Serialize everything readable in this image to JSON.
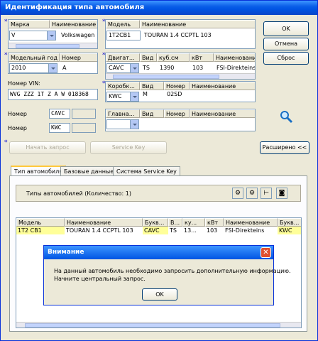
{
  "window": {
    "title": "Идентификация типа автомобиля"
  },
  "buttons": {
    "ok": "OK",
    "cancel": "Отмена",
    "reset": "Сброс",
    "start_query": "Начать запрос",
    "service_key": "Service Key",
    "advanced": "Расширено <<"
  },
  "brand": {
    "col1": "Марка",
    "col2": "Наименование",
    "value": "V",
    "name": "Volkswagen"
  },
  "model": {
    "col1": "Модель",
    "col2": "Наименование",
    "value": "1T2CB1",
    "name": "TOURAN 1.4 CCPTL 103"
  },
  "year": {
    "col1": "Модельный год",
    "col2": "Номер",
    "value": "2010",
    "number": "A"
  },
  "engine": {
    "cols": [
      "Двигат...",
      "Вид",
      "куб.см",
      "кВт",
      "Наименование"
    ],
    "values": [
      "CAVC",
      "TS",
      "1390",
      "103",
      "FSI-Direkteins"
    ]
  },
  "gearbox": {
    "cols": [
      "Коробк...",
      "Вид",
      "Номер",
      "Наименование"
    ],
    "values": [
      "KWC",
      "M",
      "02SD",
      ""
    ]
  },
  "main_gear": {
    "cols": [
      "Главна...",
      "Вид",
      "Номер",
      "Наименование"
    ]
  },
  "vin": {
    "label": "Номер VIN:",
    "value": "WVG ZZZ 1T Z A W 018368"
  },
  "numbers": {
    "label1": "Номер",
    "value1": "CAVC",
    "label2": "Номер",
    "value2": "KWC"
  },
  "tabs": [
    "Тип автомобиля",
    "Базовые данные",
    "Система Service Key"
  ],
  "types_label": "Типы автомобилей (Количество: 1)",
  "table": {
    "headers": [
      "Модель",
      "Наименование",
      "Букв...",
      "В...",
      "ку...",
      "кВт",
      "Наименование",
      "Букв..."
    ],
    "row": [
      "1T2 CB1",
      "TOURAN 1.4 CCPTL 103",
      "CAVC",
      "TS",
      "13...",
      "103",
      "FSI-Direkteins",
      "KWC"
    ]
  },
  "dialog": {
    "title": "Внимание",
    "line1": "На  данный автомобиль необходимо запросить дополнительную информацию.",
    "line2": "Начните центральный запрос.",
    "ok": "OK"
  }
}
